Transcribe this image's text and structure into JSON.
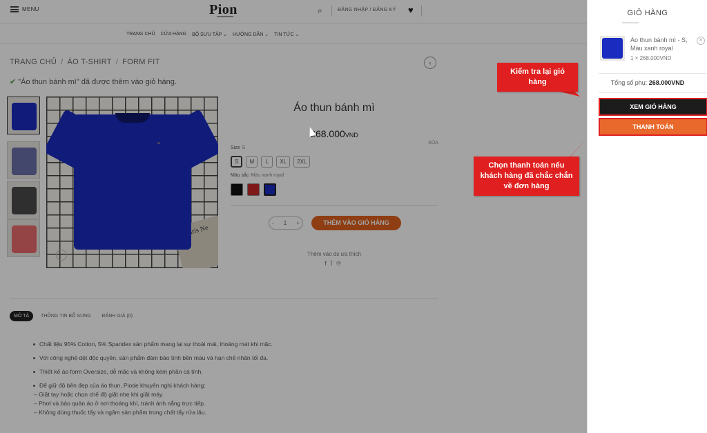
{
  "header": {
    "menu_label": "MENU",
    "logo": "Pion",
    "login_label": "ĐĂNG NHẬP / ĐĂNG KÝ"
  },
  "nav": {
    "items": [
      "TRANG CHỦ",
      "CỬA HÀNG",
      "BỘ SƯU TẬP ⌄",
      "HƯỚNG DẪN ⌄",
      "TIN TỨC ⌄"
    ]
  },
  "breadcrumb": {
    "items": [
      "TRANG CHỦ",
      "ÁO T-SHIRT",
      "FORM FIT"
    ]
  },
  "notice": "\"Áo thun bánh mì\" đã được thêm vào giỏ hàng.",
  "product": {
    "title": "Áo thun bánh mì",
    "price": "268.000",
    "currency": "VND",
    "clear_label": "XÓA",
    "size_label": "Size",
    "size_selected": "S",
    "sizes": [
      "S",
      "M",
      "L",
      "XL",
      "2XL"
    ],
    "color_label": "Màu sắc",
    "color_selected": "Màu xanh royal",
    "colors": [
      "#111111",
      "#c62828",
      "#1a2bbf"
    ],
    "qty": "1",
    "add_to_cart": "THÊM VÀO GIỎ HÀNG",
    "wishlist": "Thêm vào ds ưa thích"
  },
  "tabs": [
    "MÔ TẢ",
    "THÔNG TIN BỔ SUNG",
    "ĐÁNH GIÁ (0)"
  ],
  "description": [
    "Chất liệu 95% Cotton, 5% Spandex sản phẩm mang lại sự thoải mái, thoáng mát khi mặc.",
    "Với công nghệ dệt độc quyền, sản phẩm đảm bảo tính bền màu và hạn chế nhăn tối đa.",
    "Thiết kế áo form Oversize, dễ mặc và không kém phần cá tính.",
    "Để giữ độ bền đẹp của áo thun, Piode khuyến nghị khách hàng:"
  ],
  "care": [
    "– Giặt tay hoặc chọn chế độ giặt nhẹ khi giặt máy.",
    "– Phơi và bảo quản áo ở nơi thoáng khí, tránh ánh nắng trực tiếp.",
    "– Không dùng thuốc tẩy và ngâm sản phẩm trong chất tẩy rửa lâu."
  ],
  "callouts": {
    "check_cart": "Kiểm tra lại giỏ hàng",
    "choose_pay": "Chọn thanh toán nếu khách hàng đã chắc chắn về đơn hàng"
  },
  "cart": {
    "title": "GIỎ HÀNG",
    "item_name": "Áo thun bánh mì - S, Màu xanh royal",
    "item_price": "1 × 268.000VND",
    "subtotal_label": "Tổng số phụ:",
    "subtotal_value": "268.000VND",
    "view_cart": "XEM GIỎ HÀNG",
    "checkout": "THANH TOÁN"
  },
  "colors": {
    "accent": "#e0611f",
    "callout": "#e02020",
    "product": "#1a2bbf"
  }
}
